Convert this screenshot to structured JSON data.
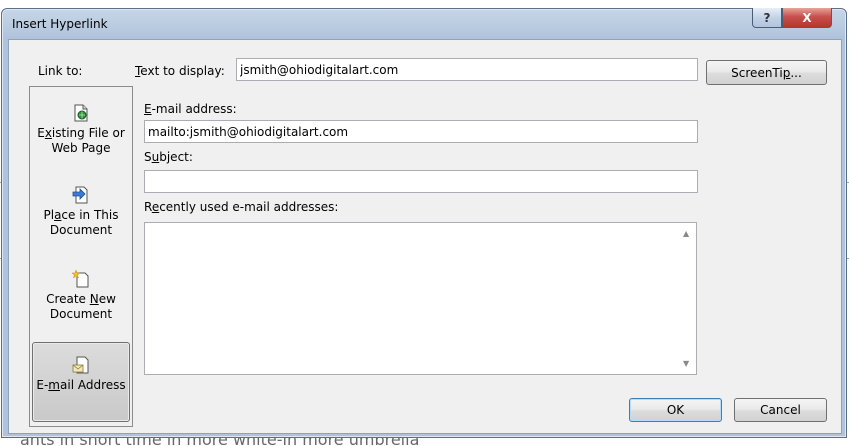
{
  "window": {
    "title": "Insert Hyperlink",
    "help_glyph": "?",
    "close_glyph": "X"
  },
  "link_to": {
    "label": "Link to:",
    "items": [
      {
        "label_prefix": "E",
        "label_underlined": "x",
        "label_rest": "isting File or\nWeb Page",
        "icon": "existing-file-icon",
        "selected": false
      },
      {
        "label_prefix": "Pl",
        "label_underlined": "a",
        "label_rest": "ce in This\nDocument",
        "icon": "place-in-document-icon",
        "selected": false
      },
      {
        "label_prefix": "Create ",
        "label_underlined": "N",
        "label_rest": "ew\nDocument",
        "icon": "new-document-icon",
        "selected": false
      },
      {
        "label_prefix": "E-",
        "label_underlined": "m",
        "label_rest": "ail Address",
        "icon": "email-address-icon",
        "selected": true
      }
    ]
  },
  "form": {
    "text_to_display": {
      "label_underlined": "T",
      "label_rest": "ext to display:",
      "value": "jsmith@ohiodigitalart.com"
    },
    "email_address": {
      "label_underlined": "E",
      "label_rest": "-mail address:",
      "value": "mailto:jsmith@ohiodigitalart.com"
    },
    "subject": {
      "label_prefix": "S",
      "label_underlined": "u",
      "label_rest": "bject:",
      "value": ""
    },
    "recent": {
      "label_prefix": "R",
      "label_underlined": "e",
      "label_rest": "cently used e-mail addresses:"
    }
  },
  "buttons": {
    "screentip": {
      "label_prefix": "ScreenTi",
      "label_underlined": "p",
      "label_rest": "..."
    },
    "ok": "OK",
    "cancel": "Cancel"
  },
  "background": {
    "text_fragment": "ants in short time in more white-in more umbrella"
  }
}
